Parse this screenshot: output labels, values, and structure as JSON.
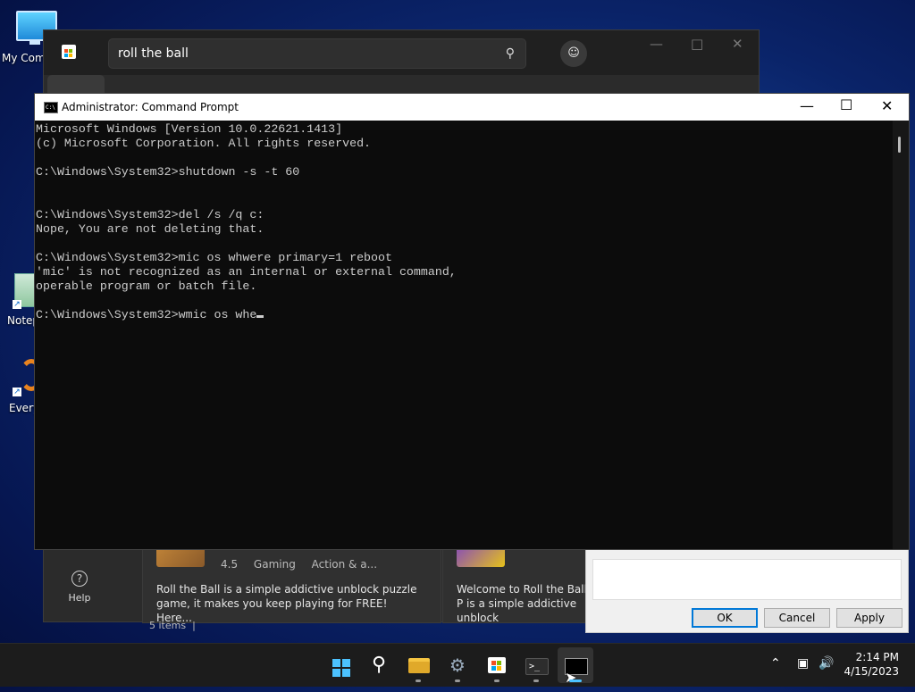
{
  "desktop": {
    "icons": [
      {
        "label": "My Com"
      },
      {
        "label": "Notep"
      },
      {
        "label": "Every"
      }
    ]
  },
  "store": {
    "search_text": "roll the ball",
    "help_label": "Help",
    "card1": {
      "rating": "4.5",
      "genre": "Gaming",
      "tags": "Action & a...",
      "description": "Roll the Ball is a simple addictive unblock puzzle game, it makes you keep playing for FREE! Here..."
    },
    "card2": {
      "description": "Welcome to Roll the Ball : P is a simple addictive unblock"
    },
    "items_count": "5 items"
  },
  "dialog": {
    "ok_label": "OK",
    "cancel_label": "Cancel",
    "apply_label": "Apply"
  },
  "cmd": {
    "title": "Administrator: Command Prompt",
    "icon_text": "C:\\",
    "lines": [
      "Microsoft Windows [Version 10.0.22621.1413]",
      "(c) Microsoft Corporation. All rights reserved.",
      "",
      "C:\\Windows\\System32>shutdown -s -t 60",
      "",
      "",
      "C:\\Windows\\System32>del /s /q c:",
      "Nope, You are not deleting that.",
      "",
      "C:\\Windows\\System32>mic os whwere primary=1 reboot",
      "'mic' is not recognized as an internal or external command,",
      "operable program or batch file.",
      "",
      "C:\\Windows\\System32>wmic os whe"
    ]
  },
  "taskbar": {
    "icons": [
      "start-icon",
      "search-icon",
      "file-explorer-icon",
      "settings-icon",
      "store-icon",
      "terminal-icon",
      "command-prompt-icon"
    ],
    "time": "2:14 PM",
    "date": "4/15/2023"
  },
  "colors": {
    "accent": "#4cc2ff",
    "console_bg": "#0c0c0c",
    "console_text": "#cccccc"
  }
}
